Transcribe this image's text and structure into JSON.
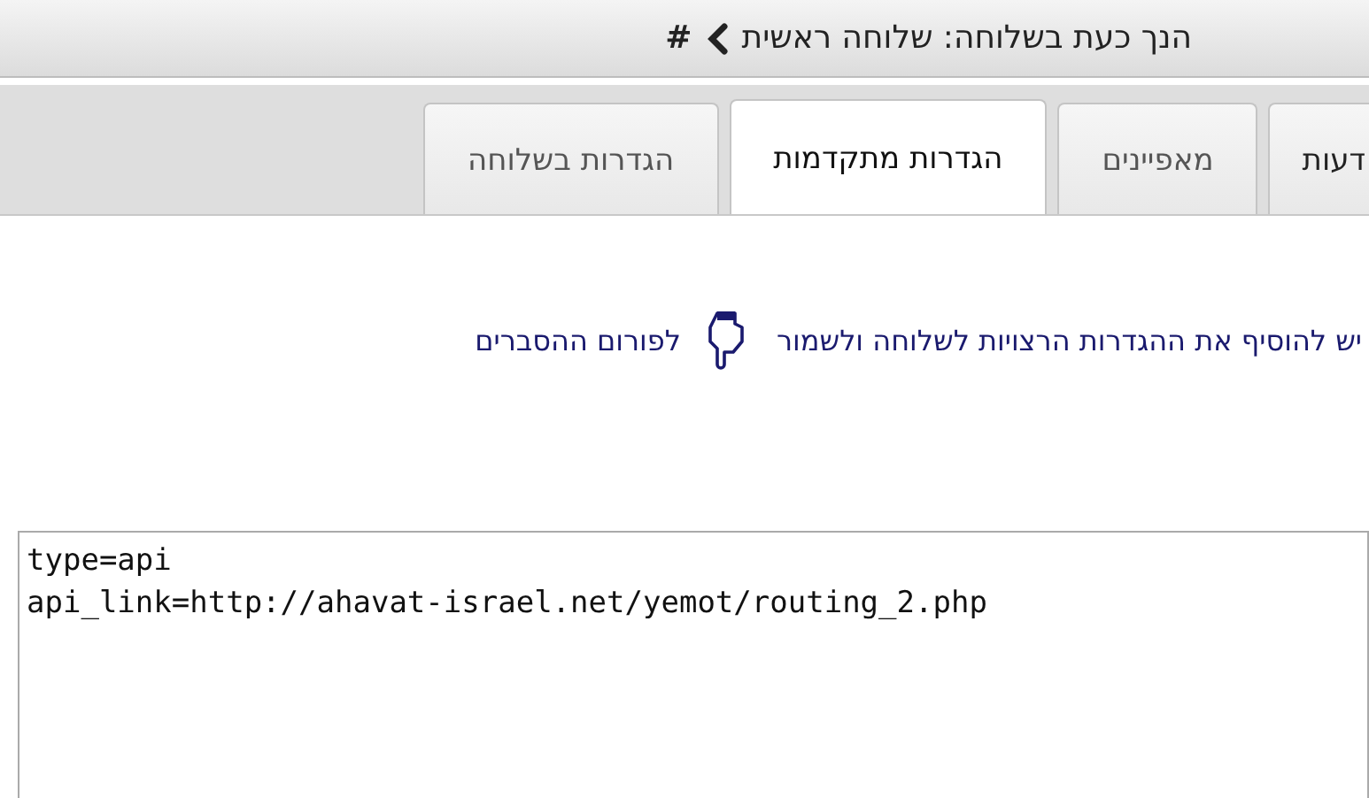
{
  "header": {
    "location": "הנך כעת בשלוחה: שלוחה ראשית",
    "hash": "#"
  },
  "tabs": [
    {
      "label": "דעות",
      "selected": false
    },
    {
      "label": "מאפיינים",
      "selected": false
    },
    {
      "label": "הגדרות מתקדמות",
      "selected": true
    },
    {
      "label": "הגדרות בשלוחה",
      "selected": false
    }
  ],
  "instruction": {
    "text": "יש להוסיף את ההגדרות הרצויות לשלוחה ולשמור",
    "link": "לפורום ההסברים"
  },
  "settings": {
    "value": "type=api\napi_link=http://ahavat-israel.net/yemot/routing_2.php"
  }
}
